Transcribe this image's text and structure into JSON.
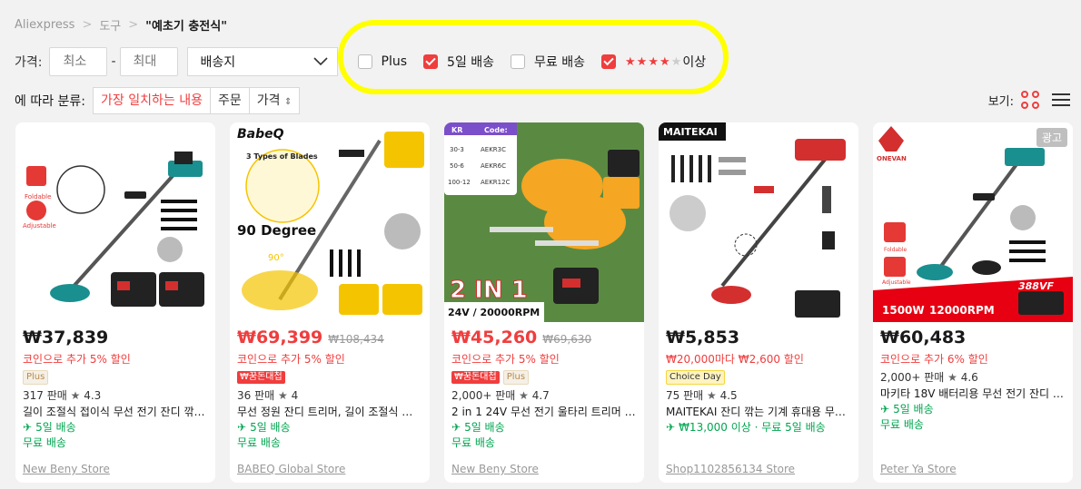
{
  "breadcrumb": {
    "home": "Aliexpress",
    "sep1": ">",
    "category": "도구",
    "sep2": ">",
    "query": "\"예초기 충전식\""
  },
  "filters": {
    "price_label": "가격:",
    "min_placeholder": "최소",
    "dash": "-",
    "max_placeholder": "최대",
    "ship_from": "배송지",
    "plus": {
      "label": "Plus",
      "checked": false
    },
    "five_day": {
      "label": "5일 배송",
      "checked": true
    },
    "free_ship": {
      "label": "무료 배송",
      "checked": false
    },
    "rating": {
      "label": "이상",
      "stars_filled": 4,
      "stars_total": 5,
      "checked": true
    }
  },
  "sort": {
    "label": "에 따라 분류:",
    "options": [
      "가장 일치하는 내용",
      "주문",
      "가격"
    ],
    "active_index": 0
  },
  "view": {
    "label": "보기:"
  },
  "colors": {
    "accent": "#f03d3d",
    "ship": "#00a650",
    "highlight": "#ffff00"
  },
  "products": [
    {
      "price": "₩37,839",
      "orig": "",
      "price_red": false,
      "promo": "코인으로 추가 5% 할인",
      "tag": "Plus",
      "tag_type": "plus",
      "sold": "317 판매",
      "rating": "4.3",
      "title": "길이 조절식 접이식 무선 전기 잔디 깎이...",
      "ship1": "5일 배송",
      "ship2": "무료 배송",
      "store": "New Beny Store",
      "ad": ""
    },
    {
      "price": "₩69,399",
      "orig": "₩108,434",
      "price_red": true,
      "promo": "코인으로 추가 5% 할인",
      "tag": "₩꿈돈대첩",
      "tag_type": "brand",
      "sold": "36 판매",
      "rating": "4",
      "title": "무선 정원 잔디 트리머, 길이 조절식 잔디...",
      "ship1": "5일 배송",
      "ship2": "무료 배송",
      "store": "BABEQ Global Store",
      "ad": ""
    },
    {
      "price": "₩45,260",
      "orig": "₩69,630",
      "price_red": true,
      "promo": "코인으로 추가 5% 할인",
      "tag": "₩꿈돈대첩",
      "tag2": "Plus",
      "tag_type": "brand",
      "sold": "2,000+ 판매",
      "rating": "4.7",
      "title": "2 in 1 24V 무선 전기 울타리 트리머 잔디...",
      "ship1": "5일 배송",
      "ship2": "무료 배송",
      "store": "New Beny Store",
      "ad": ""
    },
    {
      "price": "₩5,853",
      "orig": "",
      "price_red": false,
      "promo": "₩20,000마다 ₩2,600 할인",
      "tag": "Choice Day",
      "tag_type": "choice",
      "sold": "75 판매",
      "rating": "4.5",
      "title": "MAITEKAI 잔디 깎는 기계 휴대용 무선 전...",
      "ship1": "₩13,000 이상 · 무료 5일 배송",
      "ship2": "",
      "store": "Shop1102856134 Store",
      "ad": ""
    },
    {
      "price": "₩60,483",
      "orig": "",
      "price_red": false,
      "promo": "코인으로 추가 6% 할인",
      "tag": "",
      "tag_type": "",
      "sold": "2,000+ 판매",
      "rating": "4.6",
      "title": "마키타 18V 배터리용 무선 전기 잔디 깎이...",
      "ship1": "5일 배송",
      "ship2": "무료 배송",
      "store": "Peter Ya Store",
      "ad": "광고"
    }
  ],
  "image_text": {
    "p1": [
      "Foldable",
      "Adjustable"
    ],
    "p2": [
      "BabeQ",
      "3 Types of Blades",
      "90 Degree",
      "Free Adjustment",
      "90°"
    ],
    "p3": [
      "KR",
      "Code:",
      "30-3",
      "AEKR3C",
      "50-6",
      "AEKR6C",
      "100-12",
      "AEKR12C",
      "2 IN 1",
      "24V / 20000RPM"
    ],
    "p4": [
      "MAITEKAI"
    ],
    "p5": [
      "ONEVAN",
      "Foldable",
      "Adjustable",
      "388VF",
      "1500W",
      "12000RPM"
    ]
  }
}
